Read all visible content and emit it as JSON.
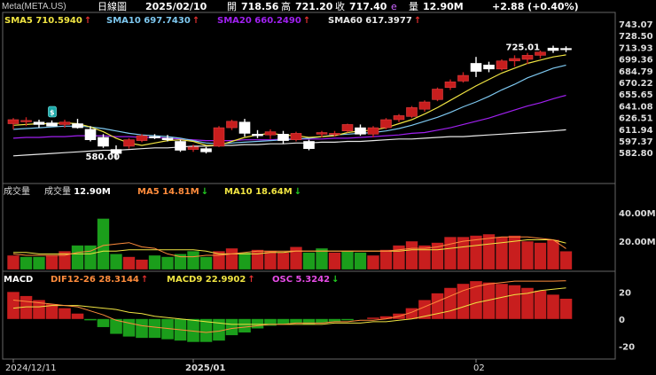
{
  "header": {
    "symbol": "Meta(META.US)",
    "period": "日線圖",
    "date": "2025/02/10",
    "open_label": "開",
    "open": "718.56",
    "high_label": "高",
    "high": "721.20",
    "close_label": "收",
    "close": "717.40",
    "close_flag": "e",
    "vol_label": "量",
    "vol": "12.90M",
    "change": "+2.88 (+0.40%)"
  },
  "colors": {
    "up": "#c81e1e",
    "down_fill": "#ffffff",
    "vol_down": "#1b9e1b",
    "sma5": "#f0e442",
    "sma10": "#7ec8f0",
    "sma20": "#a020f0",
    "sma60": "#e8e8e8",
    "ma5v": "#ff8c3c",
    "ma10v": "#f0e442"
  },
  "chart_data": [
    {
      "type": "candlestick",
      "panel": "price",
      "yticks": [
        "743.07",
        "728.50",
        "713.93",
        "699.36",
        "684.79",
        "670.22",
        "655.65",
        "641.08",
        "626.51",
        "611.94",
        "597.37",
        "582.80"
      ],
      "ylim": [
        576,
        749
      ],
      "legend": [
        {
          "name": "SMA5",
          "value": "710.5940",
          "arrow": "↑",
          "color": "#f0e442"
        },
        {
          "name": "SMA10",
          "value": "697.7430",
          "arrow": "↑",
          "color": "#7ec8f0"
        },
        {
          "name": "SMA20",
          "value": "660.2490",
          "arrow": "↑",
          "color": "#a020f0"
        },
        {
          "name": "SMA60",
          "value": "617.3977",
          "arrow": "↑",
          "color": "#e8e8e8"
        }
      ],
      "annotations": [
        {
          "text": "725.01",
          "at_bar": 39
        },
        {
          "text": "580.00",
          "at_bar": 7
        }
      ],
      "candles": [
        {
          "o": 625,
          "h": 632,
          "l": 618,
          "c": 630
        },
        {
          "o": 628,
          "h": 633,
          "l": 622,
          "c": 629
        },
        {
          "o": 627,
          "h": 630,
          "l": 620,
          "c": 624
        },
        {
          "o": 626,
          "h": 629,
          "l": 622,
          "c": 622
        },
        {
          "o": 624,
          "h": 630,
          "l": 620,
          "c": 627
        },
        {
          "o": 625,
          "h": 631,
          "l": 619,
          "c": 620
        },
        {
          "o": 618,
          "h": 622,
          "l": 603,
          "c": 605
        },
        {
          "o": 608,
          "h": 612,
          "l": 595,
          "c": 597
        },
        {
          "o": 593,
          "h": 598,
          "l": 580,
          "c": 588
        },
        {
          "o": 597,
          "h": 607,
          "l": 594,
          "c": 605
        },
        {
          "o": 604,
          "h": 612,
          "l": 602,
          "c": 610
        },
        {
          "o": 609,
          "h": 612,
          "l": 606,
          "c": 608
        },
        {
          "o": 607,
          "h": 611,
          "l": 603,
          "c": 605
        },
        {
          "o": 603,
          "h": 605,
          "l": 590,
          "c": 592
        },
        {
          "o": 593,
          "h": 599,
          "l": 590,
          "c": 596
        },
        {
          "o": 594,
          "h": 596,
          "l": 588,
          "c": 590
        },
        {
          "o": 597,
          "h": 622,
          "l": 596,
          "c": 620
        },
        {
          "o": 620,
          "h": 630,
          "l": 617,
          "c": 628
        },
        {
          "o": 627,
          "h": 631,
          "l": 609,
          "c": 613
        },
        {
          "o": 612,
          "h": 617,
          "l": 607,
          "c": 610
        },
        {
          "o": 611,
          "h": 618,
          "l": 606,
          "c": 615
        },
        {
          "o": 612,
          "h": 616,
          "l": 600,
          "c": 604
        },
        {
          "o": 605,
          "h": 615,
          "l": 603,
          "c": 613
        },
        {
          "o": 603,
          "h": 605,
          "l": 592,
          "c": 594
        },
        {
          "o": 612,
          "h": 616,
          "l": 608,
          "c": 614
        },
        {
          "o": 612,
          "h": 616,
          "l": 609,
          "c": 613
        },
        {
          "o": 616,
          "h": 625,
          "l": 614,
          "c": 624
        },
        {
          "o": 620,
          "h": 624,
          "l": 610,
          "c": 612
        },
        {
          "o": 612,
          "h": 622,
          "l": 608,
          "c": 620
        },
        {
          "o": 620,
          "h": 632,
          "l": 618,
          "c": 630
        },
        {
          "o": 630,
          "h": 637,
          "l": 627,
          "c": 635
        },
        {
          "o": 634,
          "h": 647,
          "l": 632,
          "c": 645
        },
        {
          "o": 643,
          "h": 654,
          "l": 640,
          "c": 652
        },
        {
          "o": 655,
          "h": 670,
          "l": 653,
          "c": 668
        },
        {
          "o": 670,
          "h": 680,
          "l": 667,
          "c": 677
        },
        {
          "o": 678,
          "h": 689,
          "l": 676,
          "c": 685
        },
        {
          "o": 700,
          "h": 708,
          "l": 683,
          "c": 690
        },
        {
          "o": 698,
          "h": 702,
          "l": 689,
          "c": 693
        },
        {
          "o": 693,
          "h": 705,
          "l": 691,
          "c": 703
        },
        {
          "o": 703,
          "h": 710,
          "l": 696,
          "c": 706
        },
        {
          "o": 705,
          "h": 713,
          "l": 699,
          "c": 710
        },
        {
          "o": 710,
          "h": 716,
          "l": 706,
          "c": 714
        },
        {
          "o": 719,
          "h": 722,
          "l": 713,
          "c": 716
        },
        {
          "o": 718.56,
          "h": 721.2,
          "l": 714,
          "c": 717.4
        }
      ],
      "sma5": [
        623,
        624,
        625,
        625,
        626,
        625,
        621,
        615,
        607,
        601,
        598,
        601,
        604,
        605,
        603,
        598,
        598,
        603,
        608,
        611,
        613,
        611,
        610,
        608,
        609,
        610,
        614,
        616,
        617,
        620,
        625,
        630,
        637,
        645,
        654,
        663,
        672,
        680,
        688,
        694,
        700,
        704,
        708,
        710.594
      ],
      "sma10": [
        618,
        619,
        620,
        621,
        622,
        622,
        621,
        619,
        616,
        613,
        611,
        610,
        609,
        607,
        604,
        601,
        600,
        601,
        602,
        603,
        604,
        605,
        606,
        607,
        609,
        611,
        612,
        613,
        614,
        616,
        619,
        623,
        628,
        633,
        639,
        646,
        652,
        659,
        667,
        674,
        682,
        688,
        694,
        697.743
      ],
      "sma20": [
        607,
        608,
        608,
        609,
        609,
        610,
        610,
        610,
        609,
        609,
        608,
        608,
        607,
        606,
        605,
        604,
        604,
        604,
        605,
        605,
        605,
        606,
        606,
        606,
        606,
        607,
        607,
        608,
        609,
        610,
        611,
        613,
        614,
        617,
        620,
        624,
        628,
        632,
        637,
        642,
        647,
        651,
        656,
        660.249
      ],
      "sma60": [
        585,
        586,
        587,
        588,
        589,
        590,
        591,
        592,
        592,
        593,
        594,
        595,
        595,
        596,
        597,
        597,
        598,
        598,
        599,
        599,
        600,
        600,
        601,
        601,
        602,
        602,
        603,
        603,
        604,
        605,
        606,
        606,
        607,
        608,
        609,
        609,
        610,
        611,
        612,
        613,
        614,
        615,
        616,
        617.398
      ]
    },
    {
      "type": "bar",
      "panel": "volume",
      "title": "成交量",
      "yticks": [
        "40.00M",
        "20.00M"
      ],
      "ylim": [
        0,
        52
      ],
      "legend": [
        {
          "name": "成交量",
          "value": "12.90M",
          "arrow": "",
          "color": "#ffffff"
        },
        {
          "name": "MA5",
          "value": "14.81M",
          "arrow": "↓",
          "color": "#ff8c3c"
        },
        {
          "name": "MA10",
          "value": "18.64M",
          "arrow": "↓",
          "color": "#f0e442"
        }
      ],
      "values": [
        10,
        9,
        9,
        10,
        13,
        17,
        17,
        36,
        11,
        9,
        7,
        10,
        9,
        11,
        13,
        9,
        13,
        15,
        12,
        14,
        13,
        12,
        16,
        12,
        15,
        12,
        13,
        12,
        10,
        14,
        17,
        20,
        17,
        19,
        23,
        23,
        24,
        25,
        23,
        24,
        20,
        19,
        21,
        12.9
      ],
      "up": [
        1,
        0,
        0,
        1,
        1,
        0,
        0,
        0,
        0,
        1,
        1,
        0,
        0,
        0,
        0,
        0,
        1,
        1,
        0,
        1,
        1,
        1,
        1,
        0,
        0,
        1,
        0,
        0,
        1,
        1,
        1,
        1,
        1,
        1,
        1,
        1,
        1,
        1,
        1,
        1,
        1,
        1,
        1,
        1
      ],
      "ma5": [
        11,
        10,
        10,
        10,
        10,
        12,
        13,
        17,
        18,
        19,
        16,
        15,
        11,
        9,
        9,
        10,
        10,
        11,
        12,
        13,
        13,
        13,
        13,
        13,
        13,
        13,
        13,
        13,
        13,
        13,
        14,
        15,
        15,
        16,
        18,
        20,
        21,
        22,
        23,
        23,
        23,
        22,
        21,
        14.81
      ],
      "ma10": [
        12,
        12,
        11,
        11,
        11,
        11,
        11,
        13,
        13,
        14,
        14,
        14,
        14,
        14,
        14,
        13,
        11,
        11,
        11,
        11,
        12,
        12,
        13,
        13,
        13,
        13,
        13,
        13,
        13,
        13,
        13,
        14,
        14,
        14,
        15,
        16,
        17,
        18,
        19,
        20,
        21,
        21,
        21,
        18.64
      ]
    },
    {
      "type": "bar",
      "panel": "macd",
      "title": "MACD",
      "yticks": [
        "20",
        "0",
        "-20"
      ],
      "ylim": [
        -29,
        34
      ],
      "legend": [
        {
          "name": "DIF12-26",
          "value": "28.3144",
          "arrow": "↑",
          "color": "#ff8c3c"
        },
        {
          "name": "MACD9",
          "value": "22.9902",
          "arrow": "↑",
          "color": "#f0e442"
        },
        {
          "name": "OSC",
          "value": "5.3242",
          "arrow": "↓",
          "color": "#e64ce6"
        }
      ],
      "osc": [
        20,
        17,
        14,
        11,
        8,
        4,
        -1,
        -6,
        -11,
        -13,
        -14,
        -14,
        -15,
        -16,
        -17,
        -17,
        -16,
        -12,
        -10,
        -7,
        -5,
        -4,
        -3,
        -4,
        -3,
        -2,
        -1,
        0,
        1,
        2,
        4,
        8,
        14,
        19,
        23,
        26,
        28,
        27,
        26,
        25,
        23,
        21,
        18,
        15
      ],
      "dif": [
        14,
        13,
        12,
        11,
        10,
        9,
        6,
        3,
        -1,
        -3,
        -5,
        -6,
        -7,
        -8,
        -9,
        -10,
        -9,
        -7,
        -6,
        -5,
        -4,
        -4,
        -3,
        -3,
        -3,
        -2,
        -2,
        -1,
        -1,
        0,
        2,
        5,
        9,
        13,
        17,
        21,
        24,
        26,
        27,
        28,
        28,
        28,
        28,
        28.3144
      ],
      "signal": [
        8,
        9,
        9,
        10,
        10,
        10,
        9,
        8,
        7,
        5,
        4,
        2,
        1,
        0,
        -1,
        -2,
        -3,
        -4,
        -4,
        -4,
        -4,
        -4,
        -4,
        -4,
        -4,
        -3,
        -3,
        -3,
        -2,
        -2,
        -1,
        0,
        2,
        4,
        6,
        9,
        12,
        14,
        16,
        18,
        19,
        21,
        22,
        22.9902
      ]
    }
  ],
  "xaxis": {
    "labels": [
      {
        "text": "2024/12/11",
        "at_bar": 0
      },
      {
        "text": "2025/01",
        "at_bar": 14
      },
      {
        "text": "02",
        "at_bar": 36
      }
    ]
  }
}
